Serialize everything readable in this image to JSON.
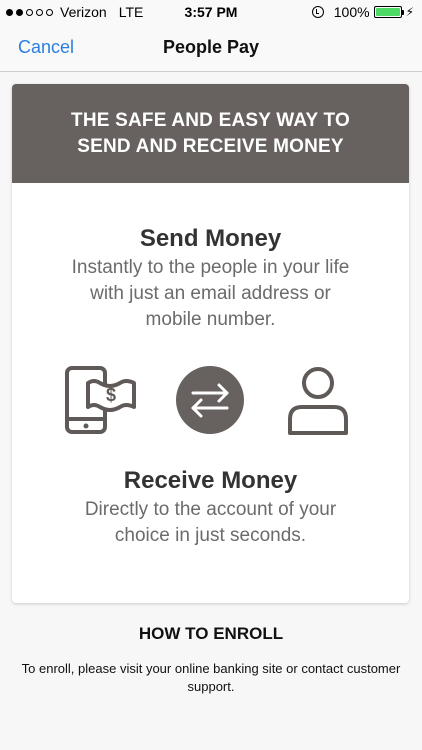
{
  "status_bar": {
    "carrier": "Verizon",
    "network": "LTE",
    "time": "3:57 PM",
    "battery_text": "100%",
    "battery_level": 1.0,
    "signal_bars": 2
  },
  "nav": {
    "cancel_label": "Cancel",
    "title": "People Pay"
  },
  "card": {
    "header_line1": "THE SAFE AND EASY WAY TO",
    "header_line2": "SEND AND RECEIVE MONEY",
    "send_title": "Send Money",
    "send_desc_line1": "Instantly to the people in your life",
    "send_desc_line2": "with just an email address or",
    "send_desc_line3": "mobile number.",
    "icons": [
      "phone-money-icon",
      "transfer-arrows-icon",
      "person-icon"
    ],
    "receive_title": "Receive Money",
    "receive_desc_line1": "Directly to the account of your",
    "receive_desc_line2": "choice in just seconds."
  },
  "enroll": {
    "heading": "HOW TO ENROLL",
    "text": "To enroll, please visit your online banking site or contact customer support."
  },
  "colors": {
    "accent": "#2b7ee0",
    "header_bg": "#67625f",
    "icon_stroke": "#5f5a57",
    "battery": "#4cd964"
  }
}
